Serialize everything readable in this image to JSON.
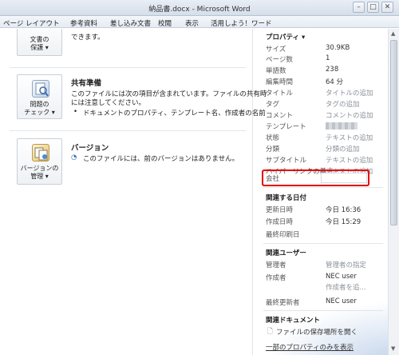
{
  "window": {
    "title": "納品書.docx - Microsoft Word"
  },
  "ribbon": {
    "tabs": [
      "ページ レイアウト",
      "参考資料",
      "差し込み文書",
      "校閲",
      "表示",
      "活用しよう！ワード"
    ]
  },
  "protect": {
    "text": "できます。",
    "button": [
      "文書の",
      "保護 ▾"
    ]
  },
  "prepare": {
    "title": "共有準備",
    "text1": "このファイルには次の項目が含まれています。ファイルの共有時",
    "text2": "には注意してください。",
    "bullet": "ドキュメントのプロパティ、テンプレート名、作成者の名前",
    "button": [
      "問題の",
      "チェック ▾"
    ]
  },
  "versions": {
    "title": "バージョン",
    "text": "このファイルには、前のバージョンはありません。",
    "button": [
      "バージョンの",
      "管理 ▾"
    ]
  },
  "properties": {
    "header": "プロパティ ▾",
    "rows": [
      {
        "key": "サイズ",
        "value": "30.9KB",
        "placeholder": false
      },
      {
        "key": "ページ数",
        "value": "1",
        "placeholder": false
      },
      {
        "key": "単語数",
        "value": "238",
        "placeholder": false
      },
      {
        "key": "編集時間",
        "value": "64 分",
        "placeholder": false
      },
      {
        "key": "タイトル",
        "value": "タイトルの追加",
        "placeholder": true
      },
      {
        "key": "タグ",
        "value": "タグの追加",
        "placeholder": true
      },
      {
        "key": "コメント",
        "value": "コメントの追加",
        "placeholder": true
      },
      {
        "key": "テンプレート",
        "value": "",
        "placeholder": false
      },
      {
        "key": "状態",
        "value": "テキストの追加",
        "placeholder": true
      },
      {
        "key": "分類",
        "value": "分類の追加",
        "placeholder": true
      },
      {
        "key": "サブタイトル",
        "value": "テキストの追加",
        "placeholder": true
      },
      {
        "key": "ハイパーリンクの基点",
        "value": "テキストの追加",
        "placeholder": true
      },
      {
        "key": "会社",
        "value": "",
        "placeholder": false
      }
    ]
  },
  "dates": {
    "header": "関連する日付",
    "rows": [
      {
        "key": "更新日時",
        "value": "今日 16:36"
      },
      {
        "key": "作成日時",
        "value": "今日 15:29"
      },
      {
        "key": "最終印刷日",
        "value": ""
      }
    ]
  },
  "people": {
    "header": "関連ユーザー",
    "manager_key": "管理者",
    "manager_value": "管理者の指定",
    "author_key": "作成者",
    "author_value": "NEC user",
    "author_add": "作成者を追...",
    "lastmod_key": "最終更新者",
    "lastmod_value": "NEC user"
  },
  "documents": {
    "header": "関連ドキュメント",
    "open_location": "ファイルの保存場所を開く",
    "show_fewer": "一部のプロパティのみを表示"
  }
}
